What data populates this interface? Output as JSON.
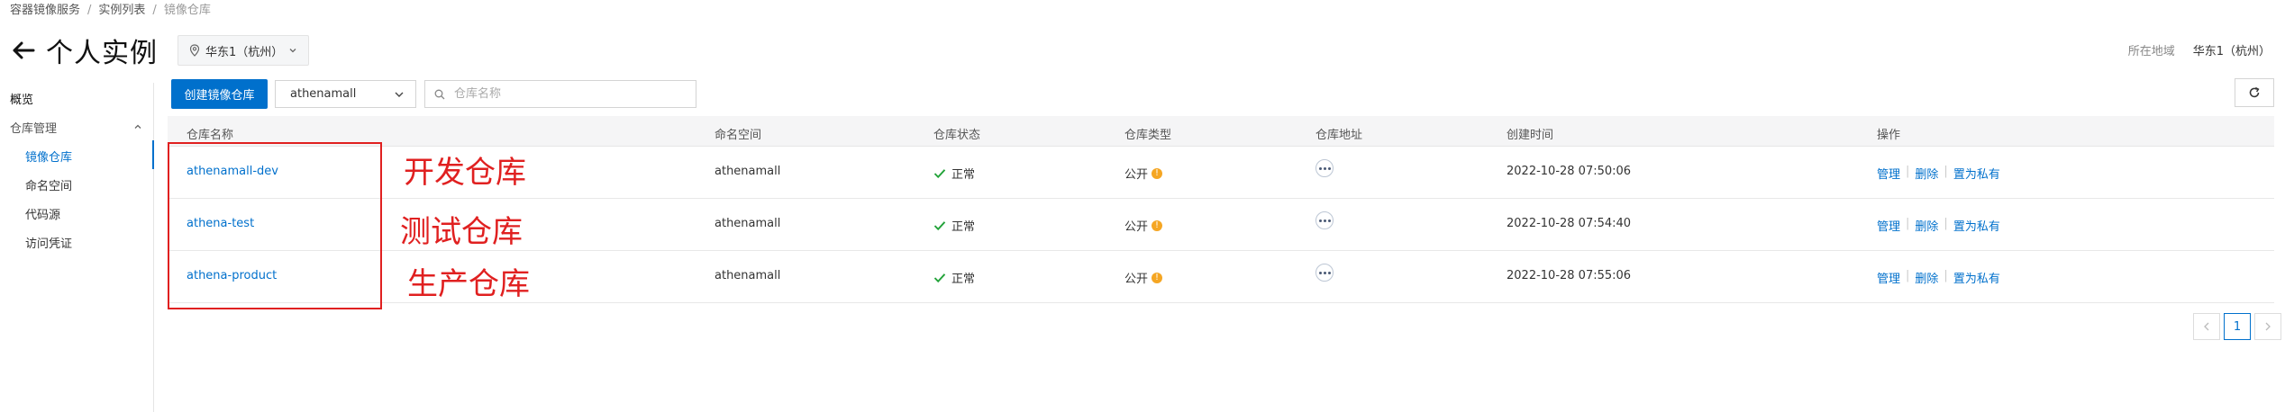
{
  "breadcrumb": [
    "容器镜像服务",
    "实例列表",
    "镜像仓库"
  ],
  "header": {
    "title": "个人实例",
    "region_select": "华东1（杭州）",
    "region_label": "所在地域",
    "region_value": "华东1（杭州）"
  },
  "sidebar": {
    "overview": "概览",
    "group": "仓库管理",
    "items": [
      "镜像仓库",
      "命名空间",
      "代码源",
      "访问凭证"
    ]
  },
  "toolbar": {
    "create_label": "创建镜像仓库",
    "namespace": "athenamall",
    "search_placeholder": "仓库名称"
  },
  "table": {
    "columns": [
      "仓库名称",
      "命名空间",
      "仓库状态",
      "仓库类型",
      "仓库地址",
      "创建时间",
      "操作"
    ],
    "rows": [
      {
        "name": "athenamall-dev",
        "namespace": "athenamall",
        "status": "正常",
        "type": "公开",
        "created": "2022-10-28 07:50:06"
      },
      {
        "name": "athena-test",
        "namespace": "athenamall",
        "status": "正常",
        "type": "公开",
        "created": "2022-10-28 07:54:40"
      },
      {
        "name": "athena-product",
        "namespace": "athenamall",
        "status": "正常",
        "type": "公开",
        "created": "2022-10-28 07:55:06"
      }
    ],
    "actions": [
      "管理",
      "删除",
      "置为私有"
    ]
  },
  "annotations": [
    "开发仓库",
    "测试仓库",
    "生产仓库"
  ],
  "pagination": {
    "current": "1"
  },
  "colors": {
    "primary": "#0070cc",
    "annotation": "#e02020",
    "success": "#23a33a",
    "warning": "#f5a623"
  }
}
